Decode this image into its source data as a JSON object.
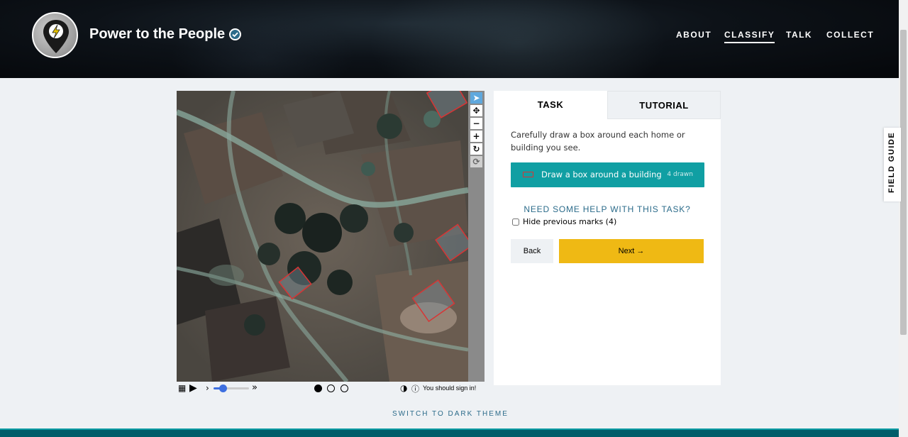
{
  "project": {
    "title": "Power to the People"
  },
  "nav": {
    "items": [
      {
        "label": "ABOUT",
        "active": false
      },
      {
        "label": "CLASSIFY",
        "active": true
      },
      {
        "label": "TALK",
        "active": false
      },
      {
        "label": "COLLECT",
        "active": false
      }
    ]
  },
  "viewer": {
    "tools": [
      "pointer-icon",
      "move-icon",
      "zoom-out-icon",
      "zoom-in-icon",
      "rotate-icon",
      "reset-icon"
    ],
    "sign_in_note": "You should sign in!",
    "frames": 3,
    "current_frame": 1
  },
  "task_panel": {
    "tabs": {
      "task": "TASK",
      "tutorial": "TUTORIAL"
    },
    "instruction": "Carefully draw a box around each home or building you see.",
    "draw_tool": {
      "label": "Draw a box around a building",
      "count": "4 drawn",
      "color": "#d93434"
    },
    "help_link": "NEED SOME HELP WITH THIS TASK?",
    "hide_marks": "Hide previous marks (4)",
    "back_button": "Back",
    "next_button": "Next"
  },
  "field_guide": "FIELD GUIDE",
  "theme_toggle": "SWITCH TO DARK THEME",
  "colors": {
    "accent_teal": "#109fa3",
    "next_yellow": "#efb914",
    "mark_red": "#d93434"
  }
}
